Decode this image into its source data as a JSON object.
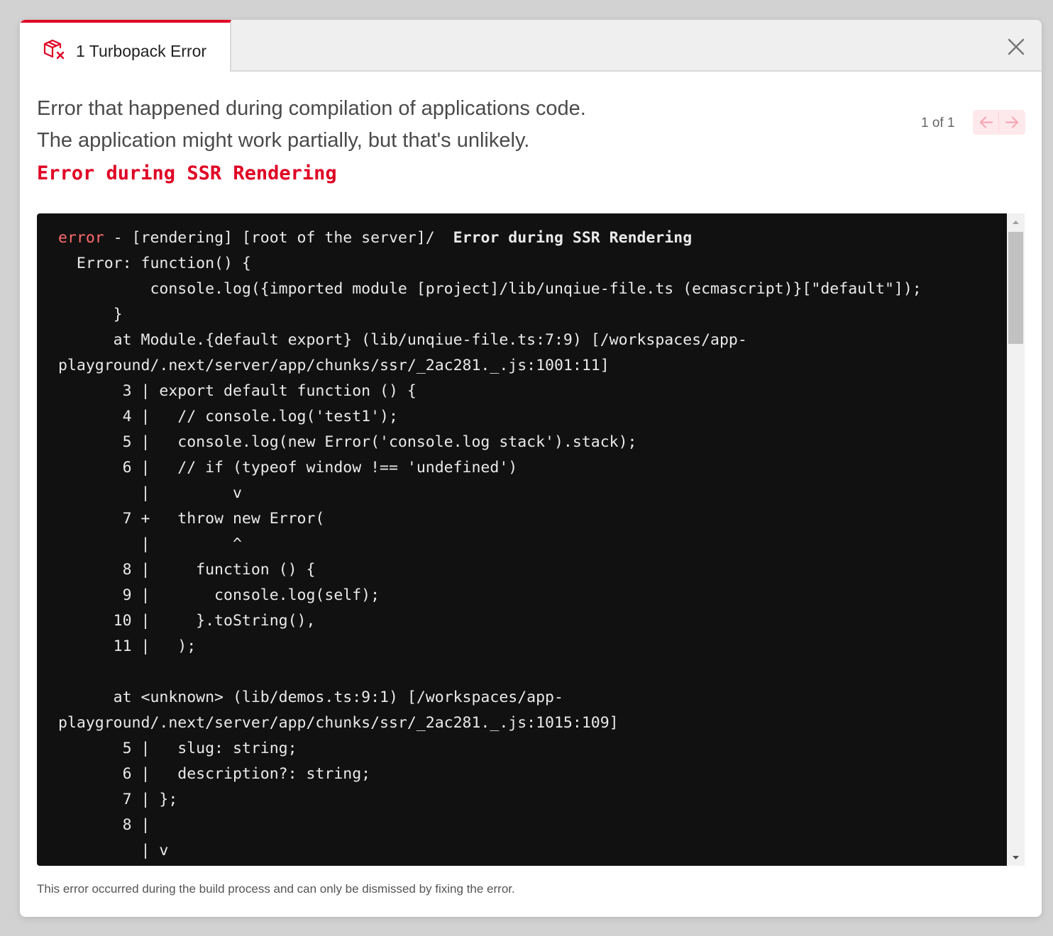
{
  "tab": {
    "count_label": "1 Turbopack Error",
    "icon": "package-error-icon"
  },
  "close": {
    "icon": "close-icon"
  },
  "header": {
    "line1": "Error that happened during compilation of applications code.",
    "line2": "The application might work partially, but that's unlikely."
  },
  "pager": {
    "text": "1 of 1",
    "prev_icon": "arrow-left-icon",
    "next_icon": "arrow-right-icon"
  },
  "error_title": "Error during SSR Rendering",
  "code": {
    "first_line": {
      "prefix": "error",
      "middle": " - [rendering] [root of the server]/  ",
      "bold": "Error during SSR Rendering"
    },
    "lines": [
      "  Error: function() {",
      "          console.log({imported module [project]/lib/unqiue-file.ts (ecmascript)}[\"default\"]);",
      "      }",
      "      at Module.{default export} (lib/unqiue-file.ts:7:9) [/workspaces/app-",
      "playground/.next/server/app/chunks/ssr/_2ac281._.js:1001:11]",
      "       3 | export default function () {",
      "       4 |   // console.log('test1');",
      "       5 |   console.log(new Error('console.log stack').stack);",
      "       6 |   // if (typeof window !== 'undefined')",
      "         |         v",
      "       7 +   throw new Error(",
      "         |         ^",
      "       8 |     function () {",
      "       9 |       console.log(self);",
      "      10 |     }.toString(),",
      "      11 |   );",
      "",
      "      at <unknown> (lib/demos.ts:9:1) [/workspaces/app-",
      "playground/.next/server/app/chunks/ssr/_2ac281._.js:1015:109]",
      "       5 |   slug: string;",
      "       6 |   description?: string;",
      "       7 | };",
      "       8 |",
      "         | v"
    ]
  },
  "footer": "This error occurred during the build process and can only be dismissed by fixing the error.",
  "colors": {
    "accent": "#e00024",
    "code_bg": "#111111",
    "error_prefix": "#ff6b6b"
  }
}
